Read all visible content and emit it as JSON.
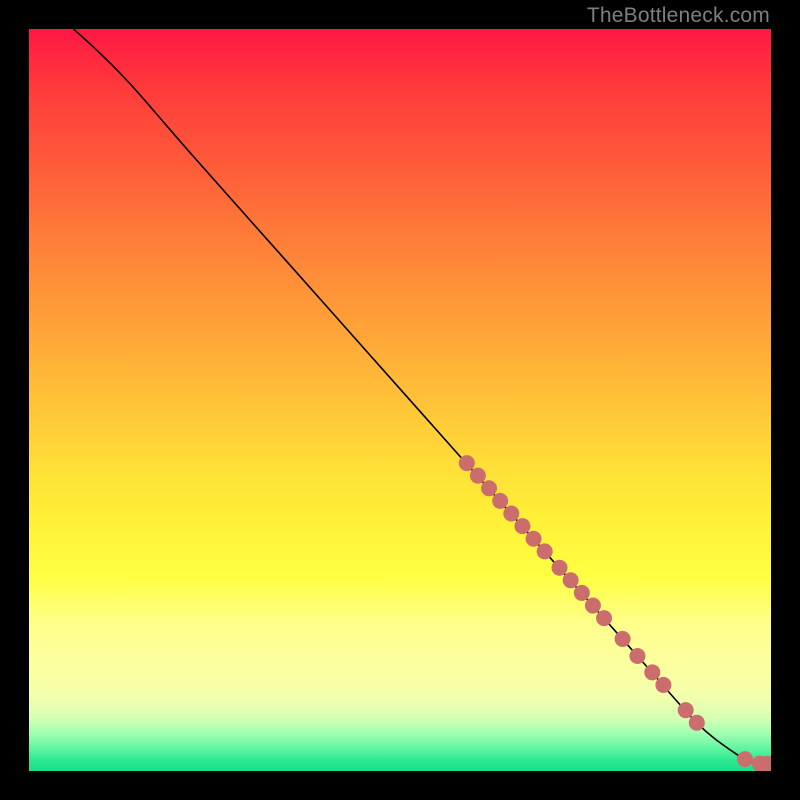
{
  "watermark": "TheBottleneck.com",
  "chart_data": {
    "type": "line",
    "title": "",
    "xlabel": "",
    "ylabel": "",
    "xlim": [
      0,
      100
    ],
    "ylim": [
      0,
      100
    ],
    "background_gradient": {
      "orientation": "vertical",
      "stops": [
        {
          "pos": 0.0,
          "color": "#ff1744"
        },
        {
          "pos": 0.5,
          "color": "#ffd238"
        },
        {
          "pos": 0.78,
          "color": "#ffff60"
        },
        {
          "pos": 1.0,
          "color": "#18df89"
        }
      ]
    },
    "series": [
      {
        "name": "curve",
        "type": "line",
        "color": "#000000",
        "points": [
          {
            "x": 6.0,
            "y": 100.0
          },
          {
            "x": 9.5,
            "y": 96.8
          },
          {
            "x": 14.0,
            "y": 92.2
          },
          {
            "x": 22.0,
            "y": 83.0
          },
          {
            "x": 34.0,
            "y": 69.5
          },
          {
            "x": 46.0,
            "y": 56.0
          },
          {
            "x": 58.0,
            "y": 42.5
          },
          {
            "x": 70.0,
            "y": 29.0
          },
          {
            "x": 82.0,
            "y": 15.5
          },
          {
            "x": 90.0,
            "y": 6.5
          },
          {
            "x": 95.0,
            "y": 2.5
          },
          {
            "x": 97.5,
            "y": 1.2
          },
          {
            "x": 99.0,
            "y": 1.0
          }
        ]
      },
      {
        "name": "markers",
        "type": "scatter",
        "color": "#cc6d6d",
        "radius": 8,
        "points": [
          {
            "x": 59.0,
            "y": 41.5
          },
          {
            "x": 60.5,
            "y": 39.8
          },
          {
            "x": 62.0,
            "y": 38.1
          },
          {
            "x": 63.5,
            "y": 36.4
          },
          {
            "x": 65.0,
            "y": 34.7
          },
          {
            "x": 66.5,
            "y": 33.0
          },
          {
            "x": 68.0,
            "y": 31.3
          },
          {
            "x": 69.5,
            "y": 29.6
          },
          {
            "x": 71.5,
            "y": 27.4
          },
          {
            "x": 73.0,
            "y": 25.7
          },
          {
            "x": 74.5,
            "y": 24.0
          },
          {
            "x": 76.0,
            "y": 22.3
          },
          {
            "x": 77.5,
            "y": 20.6
          },
          {
            "x": 80.0,
            "y": 17.8
          },
          {
            "x": 82.0,
            "y": 15.5
          },
          {
            "x": 84.0,
            "y": 13.3
          },
          {
            "x": 85.5,
            "y": 11.6
          },
          {
            "x": 88.5,
            "y": 8.2
          },
          {
            "x": 90.0,
            "y": 6.5
          },
          {
            "x": 96.5,
            "y": 1.6
          },
          {
            "x": 98.5,
            "y": 1.0
          },
          {
            "x": 99.5,
            "y": 1.0
          }
        ]
      }
    ]
  }
}
